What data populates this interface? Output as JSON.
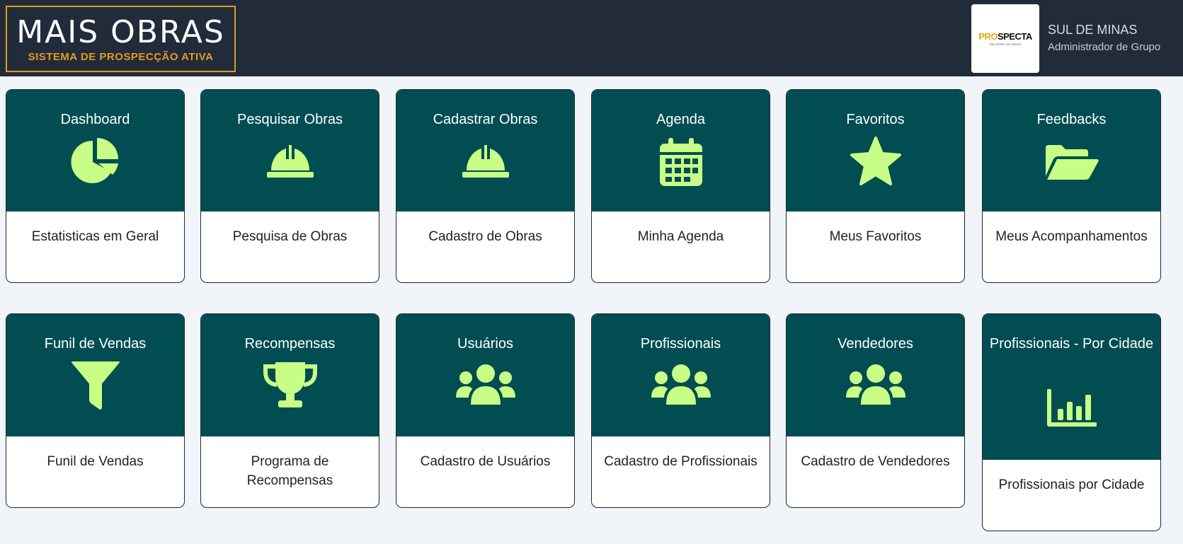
{
  "header": {
    "brand_title": "MAIS OBRAS",
    "brand_subtitle": "SISTEMA DE PROSPECÇÃO ATIVA",
    "logo_text_accent": "PRO",
    "logo_text_main": "SPECTA",
    "logo_subtext": "RELATÓRIO DE OBRAS",
    "user_name": "SUL DE MINAS",
    "user_role": "Administrador de Grupo"
  },
  "colors": {
    "header_bg": "#222b3a",
    "accent": "#e39a21",
    "card_top": "#014d52",
    "icon": "#c8fe86",
    "page_bg": "#f1f4f8"
  },
  "cards": [
    {
      "title": "Dashboard",
      "description": "Estatisticas em Geral",
      "icon": "pie-chart-icon"
    },
    {
      "title": "Pesquisar Obras",
      "description": "Pesquisa de Obras",
      "icon": "hard-hat-icon"
    },
    {
      "title": "Cadastrar Obras",
      "description": "Cadastro de Obras",
      "icon": "hard-hat-icon"
    },
    {
      "title": "Agenda",
      "description": "Minha Agenda",
      "icon": "calendar-icon"
    },
    {
      "title": "Favoritos",
      "description": "Meus Favoritos",
      "icon": "star-icon"
    },
    {
      "title": "Feedbacks",
      "description": "Meus Acompanhamentos",
      "icon": "folder-open-icon"
    },
    {
      "title": "Funil de Vendas",
      "description": "Funil de Vendas",
      "icon": "filter-icon"
    },
    {
      "title": "Recompensas",
      "description": "Programa de Recompensas",
      "icon": "trophy-icon"
    },
    {
      "title": "Usuários",
      "description": "Cadastro de Usuários",
      "icon": "users-icon"
    },
    {
      "title": "Profissionais",
      "description": "Cadastro de Profissionais",
      "icon": "users-icon"
    },
    {
      "title": "Vendedores",
      "description": "Cadastro de Vendedores",
      "icon": "users-icon"
    },
    {
      "title": "Profissionais - Por Cidade",
      "description": "Profissionais por Cidade",
      "icon": "bar-chart-icon"
    }
  ]
}
